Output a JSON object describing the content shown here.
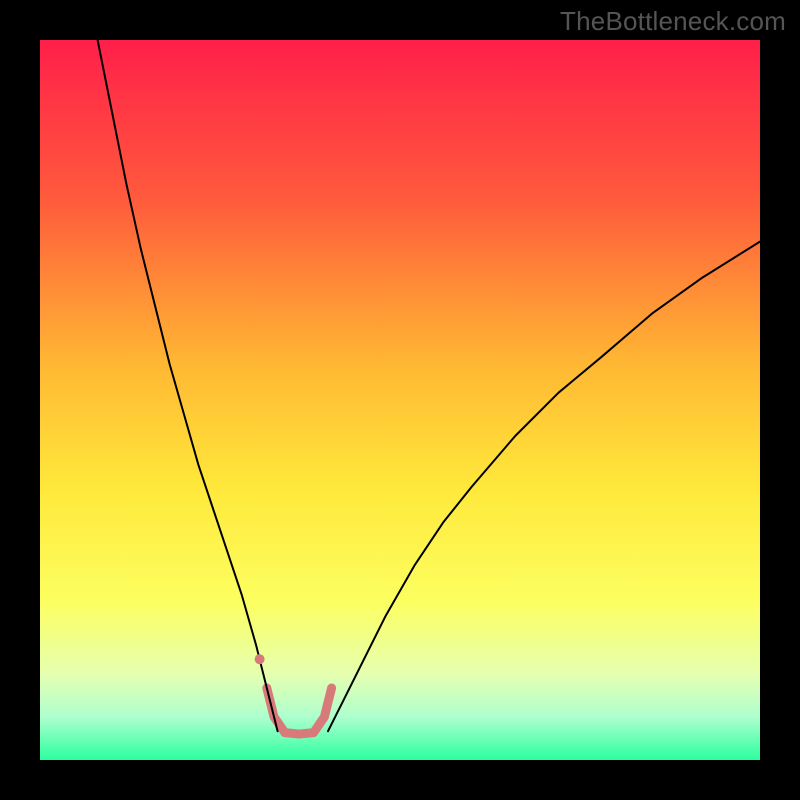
{
  "branding": {
    "text": "TheBottleneck.com"
  },
  "chart_data": {
    "type": "line",
    "title": "",
    "xlabel": "",
    "ylabel": "",
    "xlim": [
      0,
      100
    ],
    "ylim": [
      0,
      100
    ],
    "grid": false,
    "legend": false,
    "background_gradient": {
      "stops": [
        {
          "offset": 0.0,
          "color": "#ff1f4a"
        },
        {
          "offset": 0.22,
          "color": "#ff5a3c"
        },
        {
          "offset": 0.45,
          "color": "#ffb733"
        },
        {
          "offset": 0.62,
          "color": "#ffe83a"
        },
        {
          "offset": 0.78,
          "color": "#fcff60"
        },
        {
          "offset": 0.88,
          "color": "#e6ffb0"
        },
        {
          "offset": 0.94,
          "color": "#aeffce"
        },
        {
          "offset": 1.0,
          "color": "#2bff9f"
        }
      ]
    },
    "series": [
      {
        "name": "curve-left",
        "color": "#000000",
        "width": 2.0,
        "x": [
          8,
          10,
          12,
          14,
          16,
          18,
          20,
          22,
          24,
          26,
          28,
          30,
          31,
          32,
          33
        ],
        "y": [
          100,
          90,
          80,
          71,
          63,
          55,
          48,
          41,
          35,
          29,
          23,
          16,
          12,
          8,
          4
        ]
      },
      {
        "name": "curve-right",
        "color": "#000000",
        "width": 2.0,
        "x": [
          40,
          42,
          45,
          48,
          52,
          56,
          60,
          66,
          72,
          78,
          85,
          92,
          100
        ],
        "y": [
          4,
          8,
          14,
          20,
          27,
          33,
          38,
          45,
          51,
          56,
          62,
          67,
          72
        ]
      },
      {
        "name": "marker-band",
        "color": "#d97a7a",
        "width": 9.0,
        "x": [
          31.5,
          32.5,
          34,
          36,
          38,
          39.5,
          40.5
        ],
        "y": [
          10,
          6,
          3.8,
          3.6,
          3.8,
          6,
          10
        ]
      }
    ],
    "points": [
      {
        "name": "marker-dot",
        "x": 30.5,
        "y": 14,
        "r": 5,
        "color": "#d97a7a"
      }
    ]
  }
}
